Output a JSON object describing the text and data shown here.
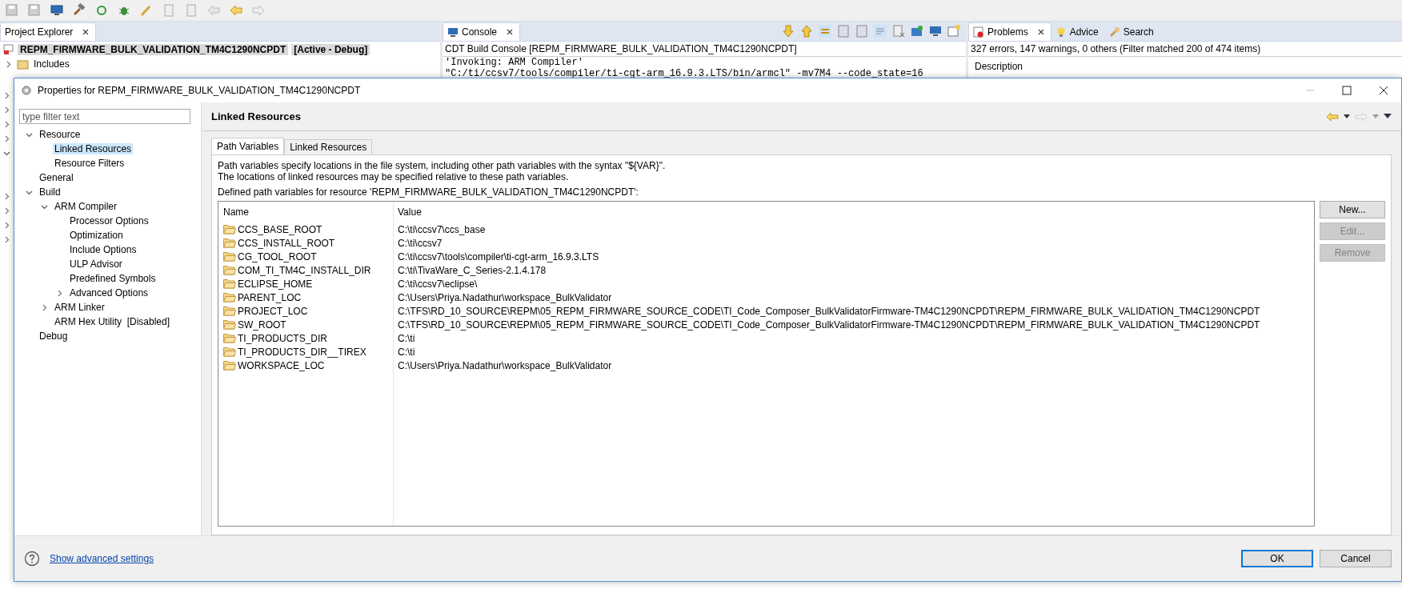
{
  "project_explorer": {
    "tab": {
      "label": "Project Explorer",
      "selected": true
    },
    "project": {
      "name": "REPM_FIRMWARE_BULK_VALIDATION_TM4C1290NCPDT",
      "status": "[Active - Debug]"
    },
    "items": [
      {
        "label": "Includes",
        "expanded": false
      }
    ],
    "hidden_rows": [
      {
        "kind": "row",
        "expanded": false
      },
      {
        "kind": "row",
        "expanded": false
      },
      {
        "kind": "row",
        "expanded": false
      },
      {
        "kind": "row",
        "expanded": false
      },
      {
        "kind": "row",
        "expanded": true
      },
      {
        "kind": "blank"
      },
      {
        "kind": "blank"
      },
      {
        "kind": "row",
        "expanded": false
      },
      {
        "kind": "row",
        "expanded": false
      },
      {
        "kind": "row",
        "expanded": false
      },
      {
        "kind": "row",
        "expanded": false
      }
    ]
  },
  "console": {
    "tab": {
      "label": "Console",
      "selected": true
    },
    "title": "CDT Build Console [REPM_FIRMWARE_BULK_VALIDATION_TM4C1290NCPDT]",
    "lines": [
      "'Invoking: ARM Compiler'",
      "\"C:/ti/ccsv7/tools/compiler/ti-cgt-arm_16.9.3.LTS/bin/armcl\" -mv7M4 --code_state=16"
    ]
  },
  "problems": {
    "tabs": [
      {
        "label": "Problems",
        "selected": true
      },
      {
        "label": "Advice",
        "selected": false
      },
      {
        "label": "Search",
        "selected": false
      }
    ],
    "summary": "327 errors, 147 warnings, 0 others (Filter matched 200 of 474 items)",
    "columns": [
      "Description"
    ]
  },
  "dialog": {
    "title": "Properties for REPM_FIRMWARE_BULK_VALIDATION_TM4C1290NCPDT",
    "filter": {
      "placeholder": "type filter text"
    },
    "tree": [
      {
        "label": "Resource",
        "selected": false,
        "expanded": true,
        "children": [
          {
            "label": "Linked Resources",
            "selected": true
          },
          {
            "label": "Resource Filters",
            "selected": false
          }
        ]
      },
      {
        "label": "General",
        "selected": false
      },
      {
        "label": "Build",
        "selected": false,
        "expanded": true,
        "children": [
          {
            "label": "ARM Compiler",
            "selected": false,
            "expanded": true,
            "children": [
              {
                "label": "Processor Options",
                "selected": false
              },
              {
                "label": "Optimization",
                "selected": false
              },
              {
                "label": "Include Options",
                "selected": false
              },
              {
                "label": "ULP Advisor",
                "selected": false
              },
              {
                "label": "Predefined Symbols",
                "selected": false
              },
              {
                "label": "Advanced Options",
                "selected": false,
                "expanded": false
              }
            ]
          },
          {
            "label": "ARM Linker",
            "selected": false,
            "expanded": false
          },
          {
            "label": "ARM Hex Utility  [Disabled]",
            "selected": false
          }
        ]
      },
      {
        "label": "Debug",
        "selected": false
      }
    ],
    "page_title": "Linked Resources",
    "tabs": [
      {
        "label": "Path Variables",
        "selected": true
      },
      {
        "label": "Linked Resources",
        "selected": false
      }
    ],
    "description": [
      "Path variables specify locations in the file system, including other path variables with the syntax \"${VAR}\".",
      "The locations of linked resources may be specified relative to these path variables."
    ],
    "table_label": "Defined path variables for resource 'REPM_FIRMWARE_BULK_VALIDATION_TM4C1290NCPDT':",
    "table": {
      "columns": [
        "Name",
        "Value"
      ],
      "rows": [
        [
          "CCS_BASE_ROOT",
          "C:\\ti\\ccsv7\\ccs_base"
        ],
        [
          "CCS_INSTALL_ROOT",
          "C:\\ti\\ccsv7"
        ],
        [
          "CG_TOOL_ROOT",
          "C:\\ti\\ccsv7\\tools\\compiler\\ti-cgt-arm_16.9.3.LTS"
        ],
        [
          "COM_TI_TM4C_INSTALL_DIR",
          "C:\\ti\\TivaWare_C_Series-2.1.4.178"
        ],
        [
          "ECLIPSE_HOME",
          "C:\\ti\\ccsv7\\eclipse\\"
        ],
        [
          "PARENT_LOC",
          "C:\\Users\\Priya.Nadathur\\workspace_BulkValidator"
        ],
        [
          "PROJECT_LOC",
          "C:\\TFS\\RD_10_SOURCE\\REPM\\05_REPM_FIRMWARE_SOURCE_CODE\\TI_Code_Composer_BulkValidatorFirmware-TM4C1290NCPDT\\REPM_FIRMWARE_BULK_VALIDATION_TM4C1290NCPDT"
        ],
        [
          "SW_ROOT",
          "C:\\TFS\\RD_10_SOURCE\\REPM\\05_REPM_FIRMWARE_SOURCE_CODE\\TI_Code_Composer_BulkValidatorFirmware-TM4C1290NCPDT\\REPM_FIRMWARE_BULK_VALIDATION_TM4C1290NCPDT"
        ],
        [
          "TI_PRODUCTS_DIR",
          "C:\\ti"
        ],
        [
          "TI_PRODUCTS_DIR__TIREX",
          "C:\\ti"
        ],
        [
          "WORKSPACE_LOC",
          "C:\\Users\\Priya.Nadathur\\workspace_BulkValidator"
        ]
      ]
    },
    "side_buttons": [
      {
        "label": "New...",
        "disabled": false
      },
      {
        "label": "Edit...",
        "disabled": true
      },
      {
        "label": "Remove",
        "disabled": true
      }
    ],
    "help_link": "Show advanced settings",
    "footer_buttons": [
      {
        "label": "OK",
        "default": true
      },
      {
        "label": "Cancel",
        "default": false
      }
    ]
  }
}
